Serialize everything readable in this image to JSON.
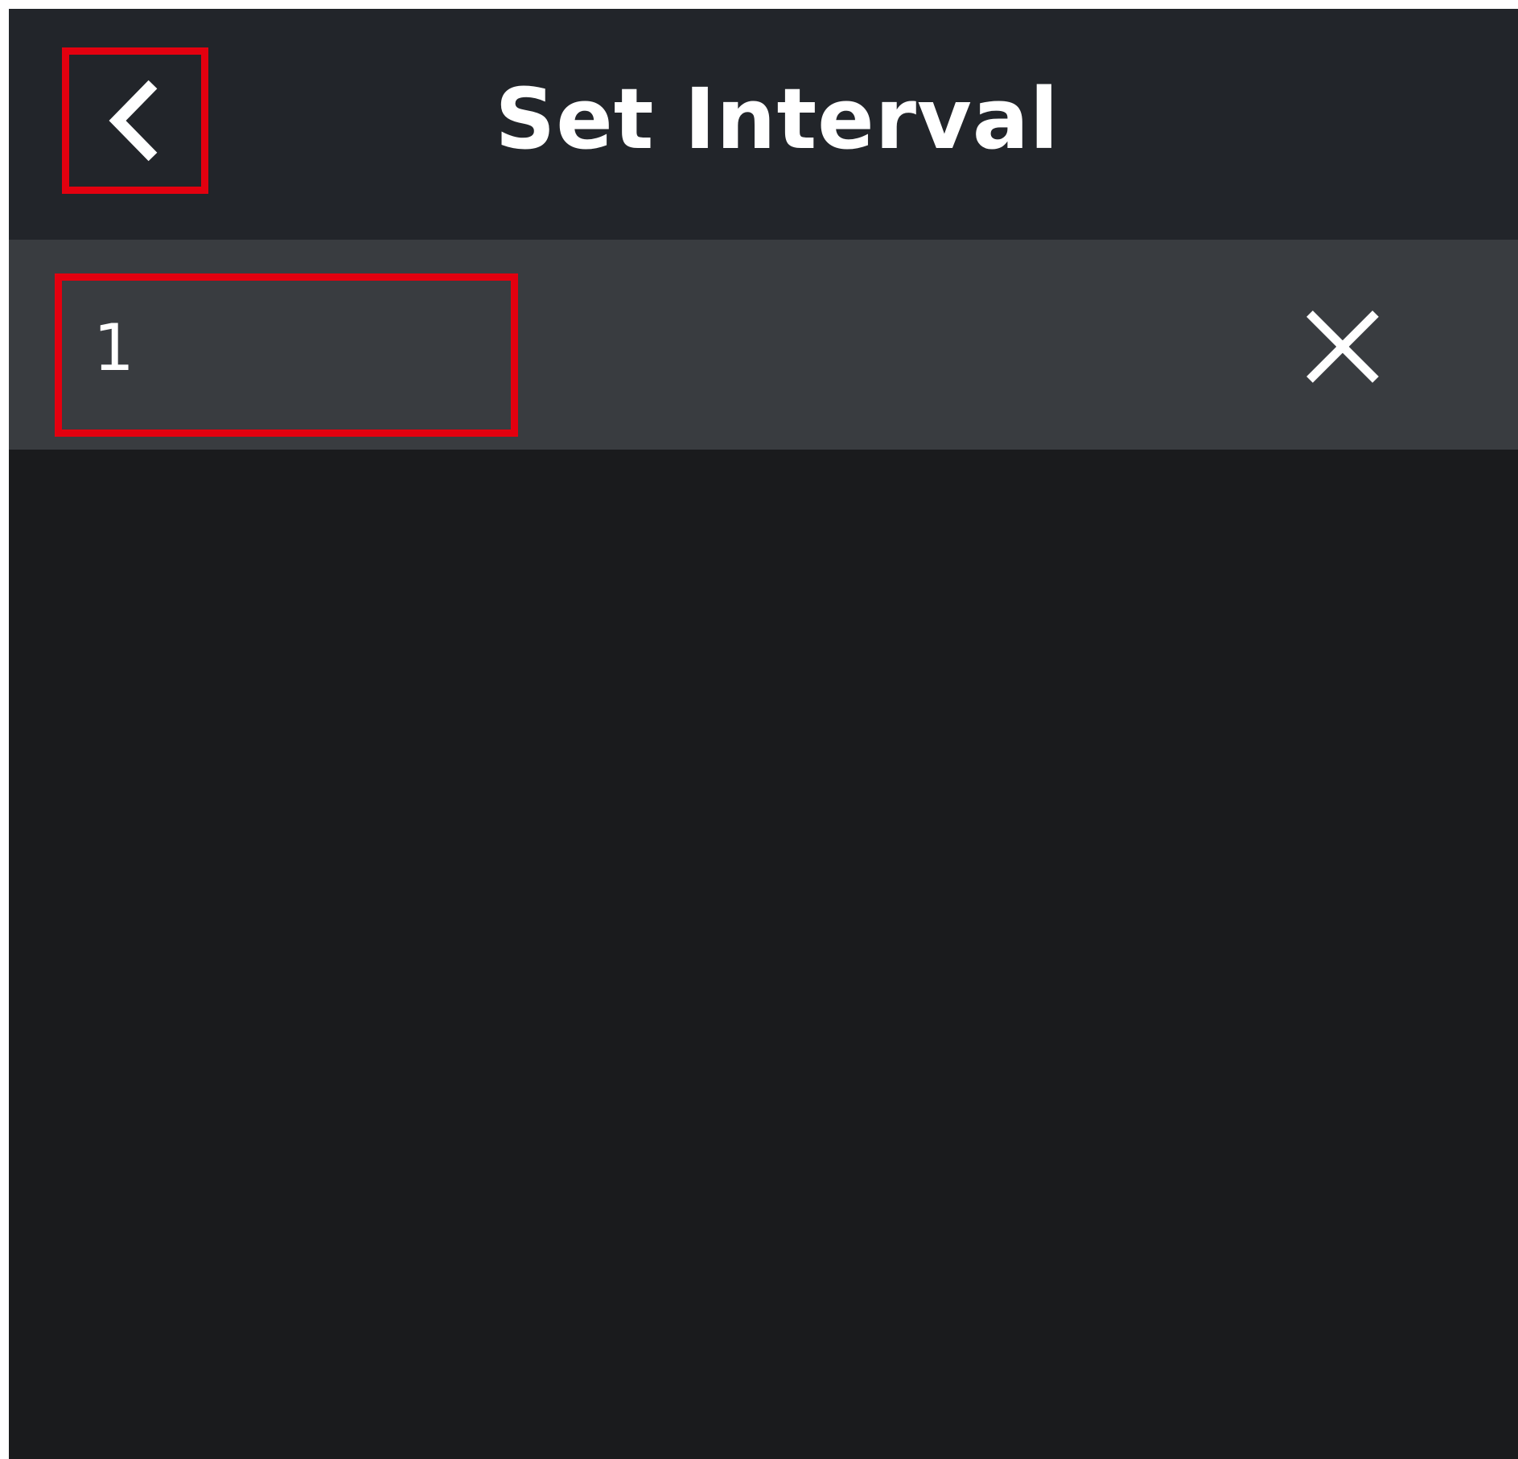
{
  "header": {
    "title": "Set Interval",
    "back_icon": "chevron-left-icon"
  },
  "interval_input": {
    "value": "1",
    "clear_icon": "close-icon"
  },
  "colors": {
    "header_background": "#22252a",
    "input_bar_background": "#393c40",
    "body_background": "#1a1b1d",
    "text": "#ffffff",
    "highlight": "#e3000f"
  }
}
